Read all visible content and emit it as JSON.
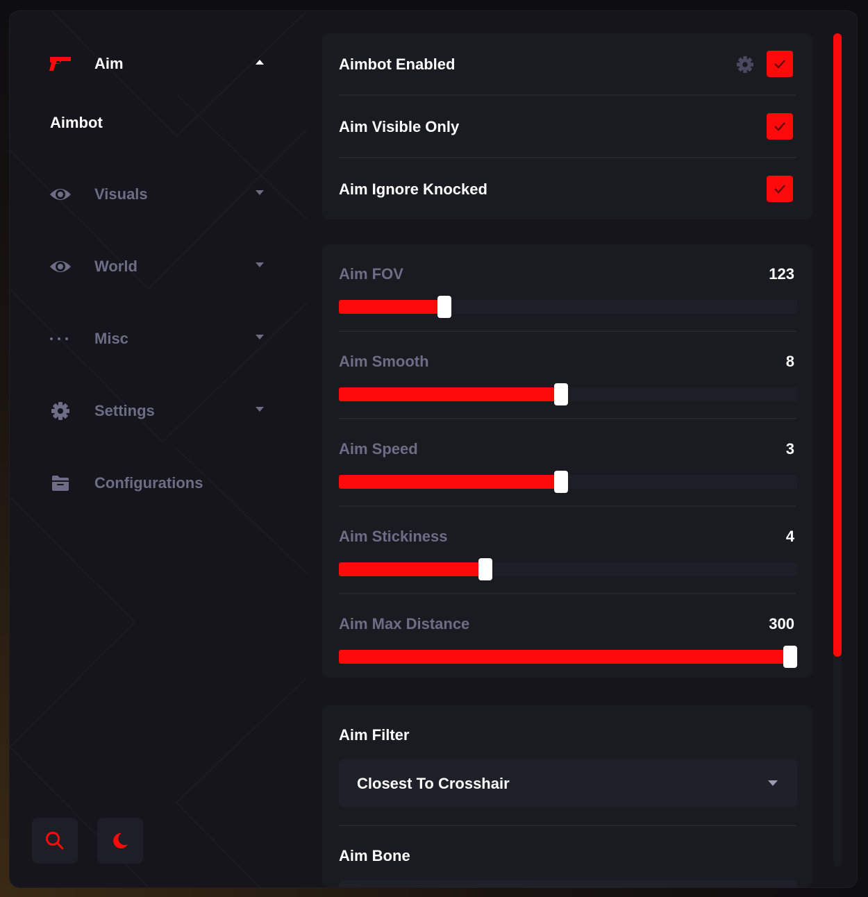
{
  "nav": {
    "aim": {
      "label": "Aim",
      "icon": "gun-icon",
      "sub": "Aimbot"
    },
    "visuals": {
      "label": "Visuals",
      "icon": "eye-icon"
    },
    "world": {
      "label": "World",
      "icon": "eye-icon"
    },
    "misc": {
      "label": "Misc",
      "icon": "ellipsis-icon"
    },
    "settings": {
      "label": "Settings",
      "icon": "gear-icon"
    },
    "configurations": {
      "label": "Configurations",
      "icon": "folder-icon"
    }
  },
  "bottom_buttons": [
    {
      "icon": "search-icon"
    },
    {
      "icon": "moon-icon"
    }
  ],
  "toggles": [
    {
      "label": "Aimbot Enabled",
      "checked": true,
      "has_settings": true
    },
    {
      "label": "Aim Visible Only",
      "checked": true
    },
    {
      "label": "Aim Ignore Knocked",
      "checked": true
    }
  ],
  "sliders": [
    {
      "label": "Aim FOV",
      "value": "123",
      "fraction": 0.23
    },
    {
      "label": "Aim Smooth",
      "value": "8",
      "fraction": 0.485
    },
    {
      "label": "Aim Speed",
      "value": "3",
      "fraction": 0.485
    },
    {
      "label": "Aim Stickiness",
      "value": "4",
      "fraction": 0.32
    },
    {
      "label": "Aim Max Distance",
      "value": "300",
      "fraction": 0.985
    }
  ],
  "aim_filter": {
    "title": "Aim Filter",
    "selected": "Closest To Crosshair"
  },
  "aim_bone": {
    "title": "Aim Bone"
  },
  "colors": {
    "accent": "#ff0a0a",
    "background": "#15151b",
    "panel": "#1a1a21",
    "muted_text": "#6e6c86"
  }
}
